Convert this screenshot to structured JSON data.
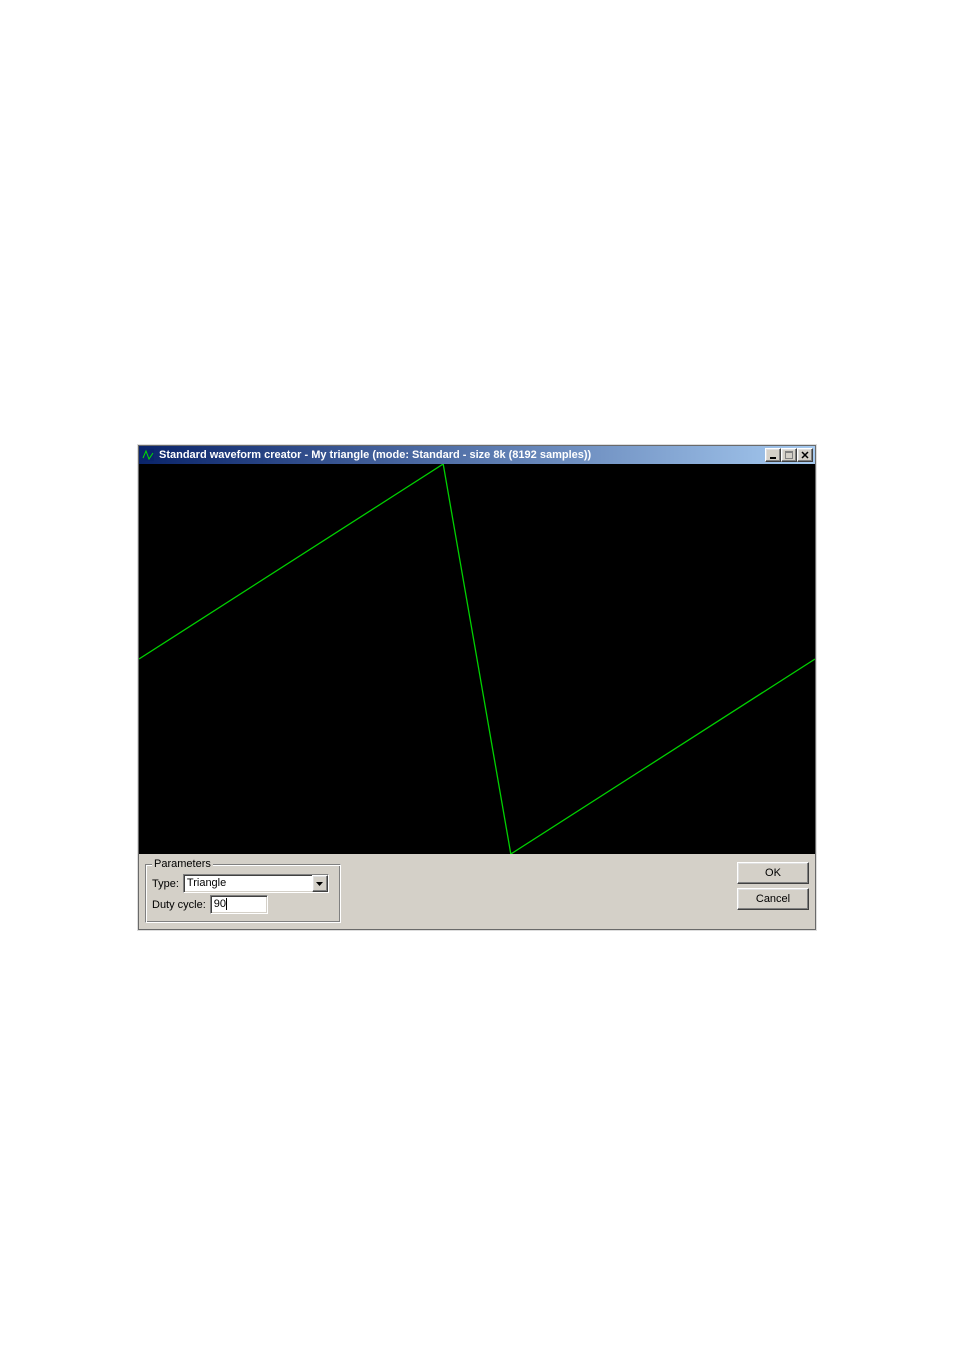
{
  "window": {
    "title": "Standard waveform creator - My triangle (mode: Standard - size 8k (8192 samples))"
  },
  "chart_data": {
    "type": "line",
    "x": [
      0,
      0.45,
      0.55,
      1.0
    ],
    "values": [
      0,
      1,
      -1,
      0
    ],
    "ylim": [
      -1,
      1
    ],
    "xlim": [
      0,
      1
    ],
    "color": "#00d000",
    "title": "",
    "xlabel": "",
    "ylabel": ""
  },
  "parameters": {
    "legend": "Parameters",
    "type_label": "Type:",
    "type_value": "Triangle",
    "duty_label": "Duty cycle:",
    "duty_value": "90"
  },
  "buttons": {
    "ok": "OK",
    "cancel": "Cancel"
  }
}
